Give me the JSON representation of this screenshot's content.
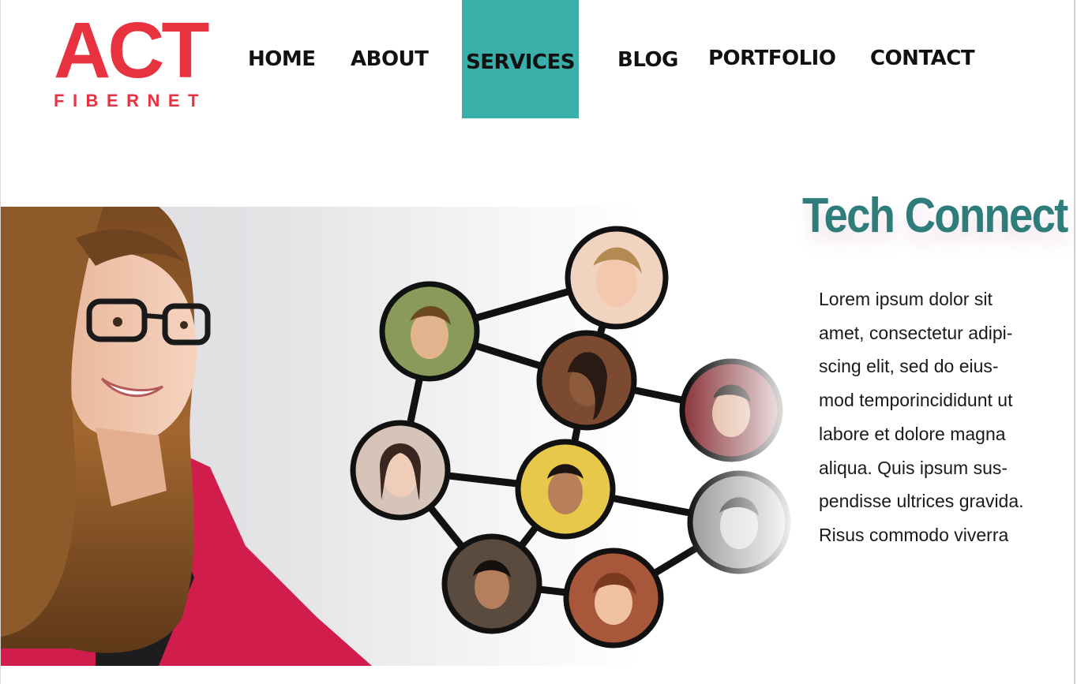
{
  "brand": {
    "logo_main": "ACT",
    "logo_sub": "FIBERNET",
    "brand_color": "#e8323f"
  },
  "nav": {
    "items": [
      "HOME",
      "ABOUT",
      "SERVICES",
      "BLOG",
      "PORTFOLIO",
      "CONTACT"
    ],
    "active": "SERVICES",
    "active_color": "#3aaea9"
  },
  "hero": {
    "headline": "Tech Connect",
    "headline_color": "#2e7d7b",
    "body_lines": [
      "Lorem ipsum dolor sit",
      "amet, consectetur adipi-",
      "scing elit, sed do eius-",
      "mod temporincididunt ut",
      "labore et dolore magna",
      "aliqua. Quis ipsum sus-",
      "pendisse ultrices gravida.",
      "Risus commodo viverra"
    ]
  }
}
